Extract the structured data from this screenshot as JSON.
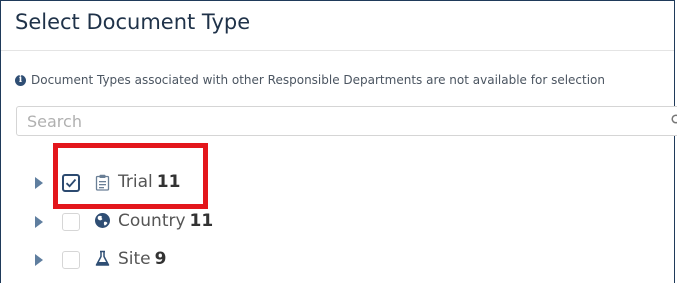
{
  "dialog": {
    "title": "Select Document Type",
    "info": "Document Types associated with other Responsible Departments are not available for selection",
    "search": {
      "placeholder": "Search",
      "value": ""
    },
    "nodes": [
      {
        "label": "Trial",
        "count": "11",
        "icon": "clipboard-icon",
        "checked": true
      },
      {
        "label": "Country",
        "count": "11",
        "icon": "globe-icon",
        "checked": false
      },
      {
        "label": "Site",
        "count": "9",
        "icon": "flask-icon",
        "checked": false
      }
    ]
  },
  "colors": {
    "highlight": "#e3161c",
    "title": "#1f3249",
    "checkbox_checked": "#2c4a70",
    "expander": "#5f7e9f"
  }
}
